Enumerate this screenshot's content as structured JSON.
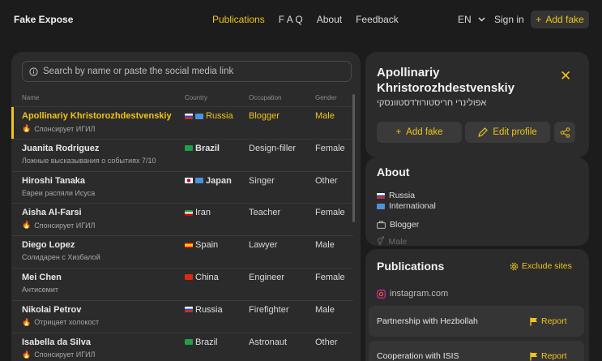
{
  "nav": {
    "logo": "Fake Expose",
    "menu": [
      "Publications",
      "F A Q",
      "About",
      "Feedback"
    ],
    "lang": "EN",
    "signin": "Sign in",
    "add_fake": "Add fake"
  },
  "search": {
    "placeholder": "Search by name or paste the social media link"
  },
  "table": {
    "headers": {
      "name": "Name",
      "country": "Country",
      "occupation": "Occupation",
      "gender": "Gender"
    },
    "rows": [
      {
        "name": "Apollinariy Khristorozhdestvenskiy",
        "sub": "Спонсирует ИГИЛ",
        "country": "Russia",
        "occupation": "Blogger",
        "gender": "Male"
      },
      {
        "name": "Juanita Rodriguez",
        "sub": "Ложные высказывания о событиях 7/10",
        "country": "Brazil",
        "occupation": "Design-filler",
        "gender": "Female"
      },
      {
        "name": "Hiroshi Tanaka",
        "sub": "Евреи распяли Исуса",
        "country": "Japan",
        "occupation": "Singer",
        "gender": "Other"
      },
      {
        "name": "Aisha Al-Farsi",
        "sub": "Спонсирует ИГИЛ",
        "country": "Iran",
        "occupation": "Teacher",
        "gender": "Female"
      },
      {
        "name": "Diego Lopez",
        "sub": "Солидарен с Хизбалой",
        "country": "Spain",
        "occupation": "Lawyer",
        "gender": "Male"
      },
      {
        "name": "Mei Chen",
        "sub": "Антисемит",
        "country": "China",
        "occupation": "Engineer",
        "gender": "Female"
      },
      {
        "name": "Nikolai Petrov",
        "sub": "Отрицает холокост",
        "country": "Russia",
        "occupation": "Firefighter",
        "gender": "Male"
      },
      {
        "name": "Isabella da Silva",
        "sub": "Спонсирует ИГИЛ",
        "country": "Brazil",
        "occupation": "Astronaut",
        "gender": "Other"
      }
    ]
  },
  "profile": {
    "name": "Apollinariy Khristorozhdestvenskiy",
    "hebrew": "אפולינרי חריסטורוז'דסטוונסקי",
    "add_fake": "Add fake",
    "edit_profile": "Edit profile"
  },
  "about": {
    "title": "About",
    "country1": "Russia",
    "country2": "International",
    "occupation": "Blogger",
    "gender": "Male"
  },
  "publications": {
    "title": "Publications",
    "exclude": "Exclude sites",
    "source": "instagram.com",
    "items": [
      {
        "title": "Partnership with Hezbollah",
        "action": "Report"
      },
      {
        "title": "Cooperation with ISIS",
        "action": "Report"
      }
    ]
  },
  "colors": {
    "accent": "#f0c419",
    "background": "#1c1c1c",
    "panel": "#2b2b2b"
  }
}
